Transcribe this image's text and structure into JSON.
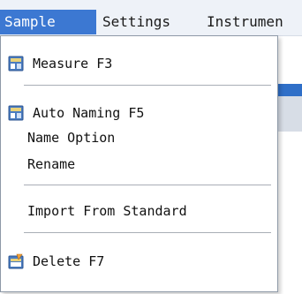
{
  "menubar": {
    "items": [
      {
        "label": "Sample",
        "active": true
      },
      {
        "label": "Settings",
        "active": false
      },
      {
        "label": "Instrumen",
        "active": false
      }
    ]
  },
  "dropdown": {
    "items": [
      {
        "label": "Measure F3",
        "icon": "measure-icon"
      },
      {
        "label": "Auto Naming F5",
        "icon": "auto-naming-icon"
      },
      {
        "label": "Name Option",
        "icon": null
      },
      {
        "label": "Rename",
        "icon": null
      },
      {
        "label": "Import From Standard",
        "icon": null
      },
      {
        "label": "Delete F7",
        "icon": "delete-icon"
      }
    ]
  },
  "colors": {
    "accent": "#3c78d2",
    "menu_bg": "#ffffff",
    "menubar_bg": "#eef2f8"
  }
}
